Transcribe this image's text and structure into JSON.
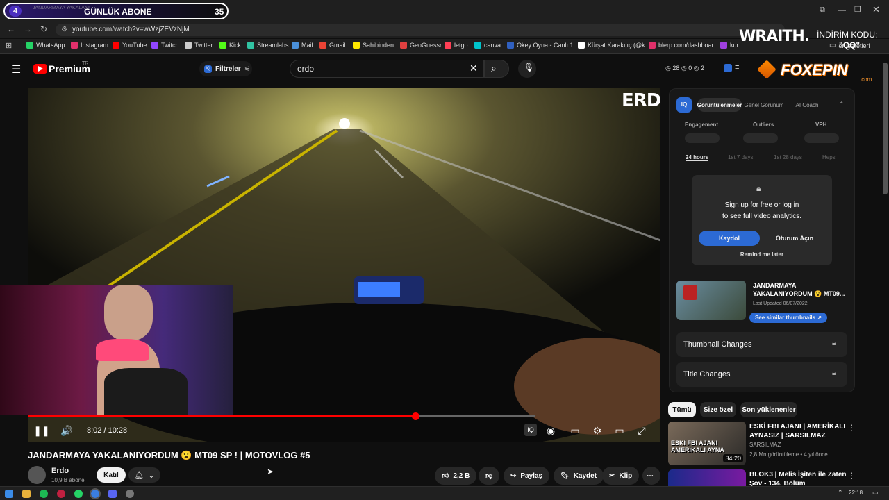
{
  "overlay": {
    "sub_count_left": "4",
    "sub_label": "GÜNLÜK ABONE",
    "sub_count_right": "35",
    "tab_text": "JANDARMAYA YAKALANI",
    "wraith": "WRAITH.",
    "discount_label": "İNDİRİM KODU:",
    "discount_code": "\"QQ\"",
    "foxepin": "FOXEPIN",
    "foxepin_sub": ".com",
    "erdo_logo": "ERDO"
  },
  "browser": {
    "url": "youtube.com/watch?v=wWzjZEVzNjM",
    "bookmarks": [
      {
        "label": "WhatsApp",
        "color": "#25d366"
      },
      {
        "label": "Instagram",
        "color": "#e1306c"
      },
      {
        "label": "YouTube",
        "color": "#ff0000"
      },
      {
        "label": "Twitch",
        "color": "#9146ff"
      },
      {
        "label": "Twitter",
        "color": "#cccccc"
      },
      {
        "label": "Kick",
        "color": "#53fc18"
      },
      {
        "label": "Streamlabs",
        "color": "#31c3a2"
      },
      {
        "label": "Mail",
        "color": "#4a90d9"
      },
      {
        "label": "Gmail",
        "color": "#ea4335"
      },
      {
        "label": "Sahibinden",
        "color": "#ffe800"
      },
      {
        "label": "GeoGuessr",
        "color": "#e04040"
      },
      {
        "label": "letgo",
        "color": "#ff3f55"
      },
      {
        "label": "canva",
        "color": "#00c4cc"
      },
      {
        "label": "Okey Oyna - Canlı 1...",
        "color": "#3060c0"
      },
      {
        "label": "Kürşat Karakılıç (@k...",
        "color": "#ffffff"
      },
      {
        "label": "blerp.com/dashboar...",
        "color": "#e0306a"
      },
      {
        "label": "kur",
        "color": "#a040e0"
      }
    ],
    "other_bookmarks": "er İşaretleri"
  },
  "youtube": {
    "brand": "Premium",
    "brand_sup": "TR",
    "filters_label": "Filtreler",
    "search_value": "erdo",
    "header_stats": {
      "a": "28",
      "b": "0",
      "c": "2"
    }
  },
  "video": {
    "time": "8:02 / 10:28",
    "progress_fraction": 0.765,
    "buffer_fraction": 0.8,
    "title": "JANDARMAYA YAKALANIYORDUM 😮 MT09 SP ! | MOTOVLOG #5",
    "channel": "Erdo",
    "subs": "10,9 B abone",
    "join": "Katıl",
    "likes": "2,2 B",
    "share": "Paylaş",
    "save": "Kaydet",
    "clip": "Klip"
  },
  "panel": {
    "tabs": [
      "Görüntülenmeler",
      "Genel Görünüm",
      "AI Coach"
    ],
    "metrics": [
      "Engagement",
      "Outliers",
      "VPH"
    ],
    "ranges": [
      "24 hours",
      "1st 7 days",
      "1st 28 days",
      "Hepsi"
    ],
    "signup_line1": "Sign up for free or log in",
    "signup_line2": "to see full video analytics.",
    "register": "Kaydol",
    "login": "Oturum Açın",
    "remind": "Remind me later",
    "video_title": "JANDARMAYA YAKALANIYORDUM 😮 MT09...",
    "last_updated": "Last Updated 06/07/2022",
    "similar": "See similar thumbnails ↗",
    "thumb_changes": "Thumbnail Changes",
    "title_changes": "Title Changes"
  },
  "chips": [
    "Tümü",
    "Size özel",
    "Son yüklenenler"
  ],
  "recommendations": [
    {
      "title": "ESKİ FBI AJANI | AMERİKALI AYNASIZ | SARSILMAZ",
      "channel": "SARSILMAZ",
      "meta": "2,8 Mn görüntüleme • 4 yıl önce",
      "duration": "34:20",
      "thumb_text": "ESKİ FBI AJANI AMERİKALI AYNA"
    },
    {
      "title": "BLOK3 | Melis İşiten ile Zaten Şov - 134. Bölüm",
      "channel": "",
      "meta": "",
      "duration": "",
      "thumb_text": ""
    }
  ],
  "taskbar": {
    "time": "22:18"
  }
}
